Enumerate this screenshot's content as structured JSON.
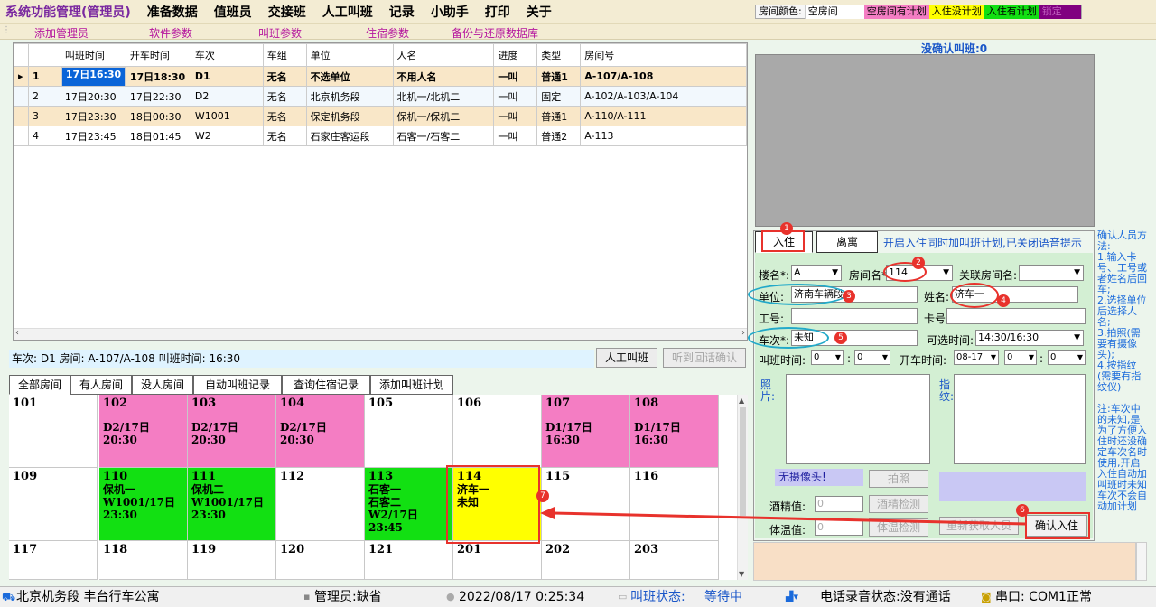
{
  "menubar": {
    "items": [
      "系统功能管理(管理员)",
      "准备数据",
      "值班员",
      "交接班",
      "人工叫班",
      "记录",
      "小助手",
      "打印",
      "关于"
    ]
  },
  "room_color_legend": {
    "label": "房间颜色:",
    "items": [
      {
        "label": "空房间",
        "color": "#ffffff"
      },
      {
        "label": "空房间有计划",
        "color": "#f47dc3"
      },
      {
        "label": "入住没计划",
        "color": "#ffff00"
      },
      {
        "label": "入住有计划",
        "color": "#12e012"
      },
      {
        "label": "锁定",
        "color": "#800080"
      }
    ]
  },
  "submenu": {
    "items": [
      "添加管理员",
      "软件参数",
      "叫班参数",
      "住宿参数",
      "备份与还原数据库"
    ]
  },
  "call_grid": {
    "columns": [
      "",
      "",
      "叫班时间",
      "开车时间",
      "车次",
      "车组",
      "单位",
      "人名",
      "进度",
      "类型",
      "房间号"
    ],
    "rows": [
      [
        "▸",
        "1",
        "17日16:30",
        "17日18:30",
        "D1",
        "无名",
        "不选单位",
        "不用人名",
        "一叫",
        "普通1",
        "A-107/A-108"
      ],
      [
        "",
        "2",
        "17日20:30",
        "17日22:30",
        "D2",
        "无名",
        "北京机务段",
        "北机一/北机二",
        "一叫",
        "固定",
        "A-102/A-103/A-104"
      ],
      [
        "",
        "3",
        "17日23:30",
        "18日00:30",
        "W1001",
        "无名",
        "保定机务段",
        "保机一/保机二",
        "一叫",
        "普通1",
        "A-110/A-111"
      ],
      [
        "",
        "4",
        "17日23:45",
        "18日01:45",
        "W2",
        "无名",
        "石家庄客运段",
        "石客一/石客二",
        "一叫",
        "普通2",
        "A-113"
      ]
    ]
  },
  "info_line": "车次: D1 房间: A-107/A-108  叫班时间: 16:30",
  "buttons": {
    "manual_call": "人工叫班",
    "confirm_callback": "听到回话确认"
  },
  "room_tabs": [
    "全部房间",
    "有人房间",
    "没人房间",
    "自动叫班记录",
    "查询住宿记录",
    "添加叫班计划"
  ],
  "rooms": [
    {
      "num": "101",
      "lines": [],
      "color": "#ffffff"
    },
    {
      "num": "102",
      "lines": [
        "",
        "D2/17日",
        "20:30"
      ],
      "color": "#f47dc3"
    },
    {
      "num": "103",
      "lines": [
        "",
        "D2/17日",
        "20:30"
      ],
      "color": "#f47dc3"
    },
    {
      "num": "104",
      "lines": [
        "",
        "D2/17日",
        "20:30"
      ],
      "color": "#f47dc3"
    },
    {
      "num": "105",
      "lines": [],
      "color": "#ffffff"
    },
    {
      "num": "106",
      "lines": [],
      "color": "#ffffff"
    },
    {
      "num": "107",
      "lines": [
        "",
        "D1/17日",
        "16:30"
      ],
      "color": "#f47dc3"
    },
    {
      "num": "108",
      "lines": [
        "",
        "D1/17日",
        "16:30"
      ],
      "color": "#f47dc3"
    },
    {
      "num": "109",
      "lines": [],
      "color": "#ffffff"
    },
    {
      "num": "110",
      "lines": [
        "保机一",
        "W1001/17日",
        "23:30"
      ],
      "color": "#12e012"
    },
    {
      "num": "111",
      "lines": [
        "保机二",
        "W1001/17日",
        "23:30"
      ],
      "color": "#12e012"
    },
    {
      "num": "112",
      "lines": [],
      "color": "#ffffff"
    },
    {
      "num": "113",
      "lines": [
        "石客一",
        "石客二",
        "W2/17日",
        "23:45"
      ],
      "color": "#12e012"
    },
    {
      "num": "114",
      "lines": [
        "济车一",
        "未知"
      ],
      "color": "#ffff00"
    },
    {
      "num": "115",
      "lines": [],
      "color": "#ffffff"
    },
    {
      "num": "116",
      "lines": [],
      "color": "#ffffff"
    },
    {
      "num": "117",
      "lines": [],
      "color": "#ffffff"
    },
    {
      "num": "118",
      "lines": [],
      "color": "#ffffff"
    },
    {
      "num": "119",
      "lines": [],
      "color": "#ffffff"
    },
    {
      "num": "120",
      "lines": [],
      "color": "#ffffff"
    },
    {
      "num": "121",
      "lines": [],
      "color": "#ffffff"
    },
    {
      "num": "201",
      "lines": [],
      "color": "#ffffff"
    },
    {
      "num": "202",
      "lines": [],
      "color": "#ffffff"
    },
    {
      "num": "203",
      "lines": [],
      "color": "#ffffff"
    }
  ],
  "right_panel": {
    "unconfirmed": "没确认叫班:0",
    "tab_checkin": "入住",
    "tab_checkout": "离寓",
    "notice": "开启入住同时加叫班计划,已关闭语音提示",
    "building_label": "楼名*:",
    "building_value": "A",
    "room_label": "房间名*:",
    "room_value": "114",
    "related_room_label": "关联房间名:",
    "unit_label": "单位:",
    "unit_value": "济南车辆段",
    "name_label": "姓名:",
    "name_value": "济车一",
    "work_no_label": "工号:",
    "card_label": "卡号:",
    "train_label": "车次*:",
    "train_value": "未知",
    "optional_time_label": "可选时间:",
    "optional_time_value": "14:30/16:30",
    "call_time_label": "叫班时间:",
    "call_hour": "0",
    "call_min": "0",
    "depart_time_label": "开车时间:",
    "depart_date": "08-17",
    "depart_hour": "0",
    "depart_min": "0",
    "photo_label": "照片:",
    "fingerprint_label": "指纹:",
    "no_camera": "无摄像头!",
    "photo_btn": "拍照",
    "alcohol_label": "酒精值:",
    "alcohol_value": "0",
    "alcohol_btn": "酒精检测",
    "temp_label": "体温值:",
    "temp_value": "0",
    "temp_btn": "体温检测",
    "refetch_btn": "重新获取人员",
    "confirm_btn": "确认入住"
  },
  "instructions": "确认人员方法:\n1.输入卡号、工号或者姓名后回车;\n2.选择单位后选择人名;\n3.拍照(需要有摄像头);\n4.按指纹(需要有指纹仪)\n\n注:车次中的未知,是为了方便入住时还没确定车次名时使用,开启入住自动加叫班时未知车次不会自动加计划",
  "markers": [
    "1",
    "2",
    "3",
    "4",
    "5",
    "6",
    "7"
  ],
  "status_bar": {
    "location": "北京机务段 丰台行车公寓",
    "admin": "管理员:缺省",
    "datetime": "2022/08/17 0:25:34",
    "call_status_label": "叫班状态:",
    "call_status_value": "等待中",
    "phone_record": "电话录音状态:没有通话",
    "serial_port": "串口: COM1正常"
  },
  "colors": {
    "menubar_bg": "#f3ecd3",
    "title_purple": "#7a28a0",
    "submenu_magenta": "#b5169e",
    "selected_blue": "#0a64d8",
    "row_highlight": "#f9e7c8",
    "annotation_red": "#e8322c",
    "annotation_cyan": "#22a9c9",
    "panel_green": "#d3efd3"
  }
}
